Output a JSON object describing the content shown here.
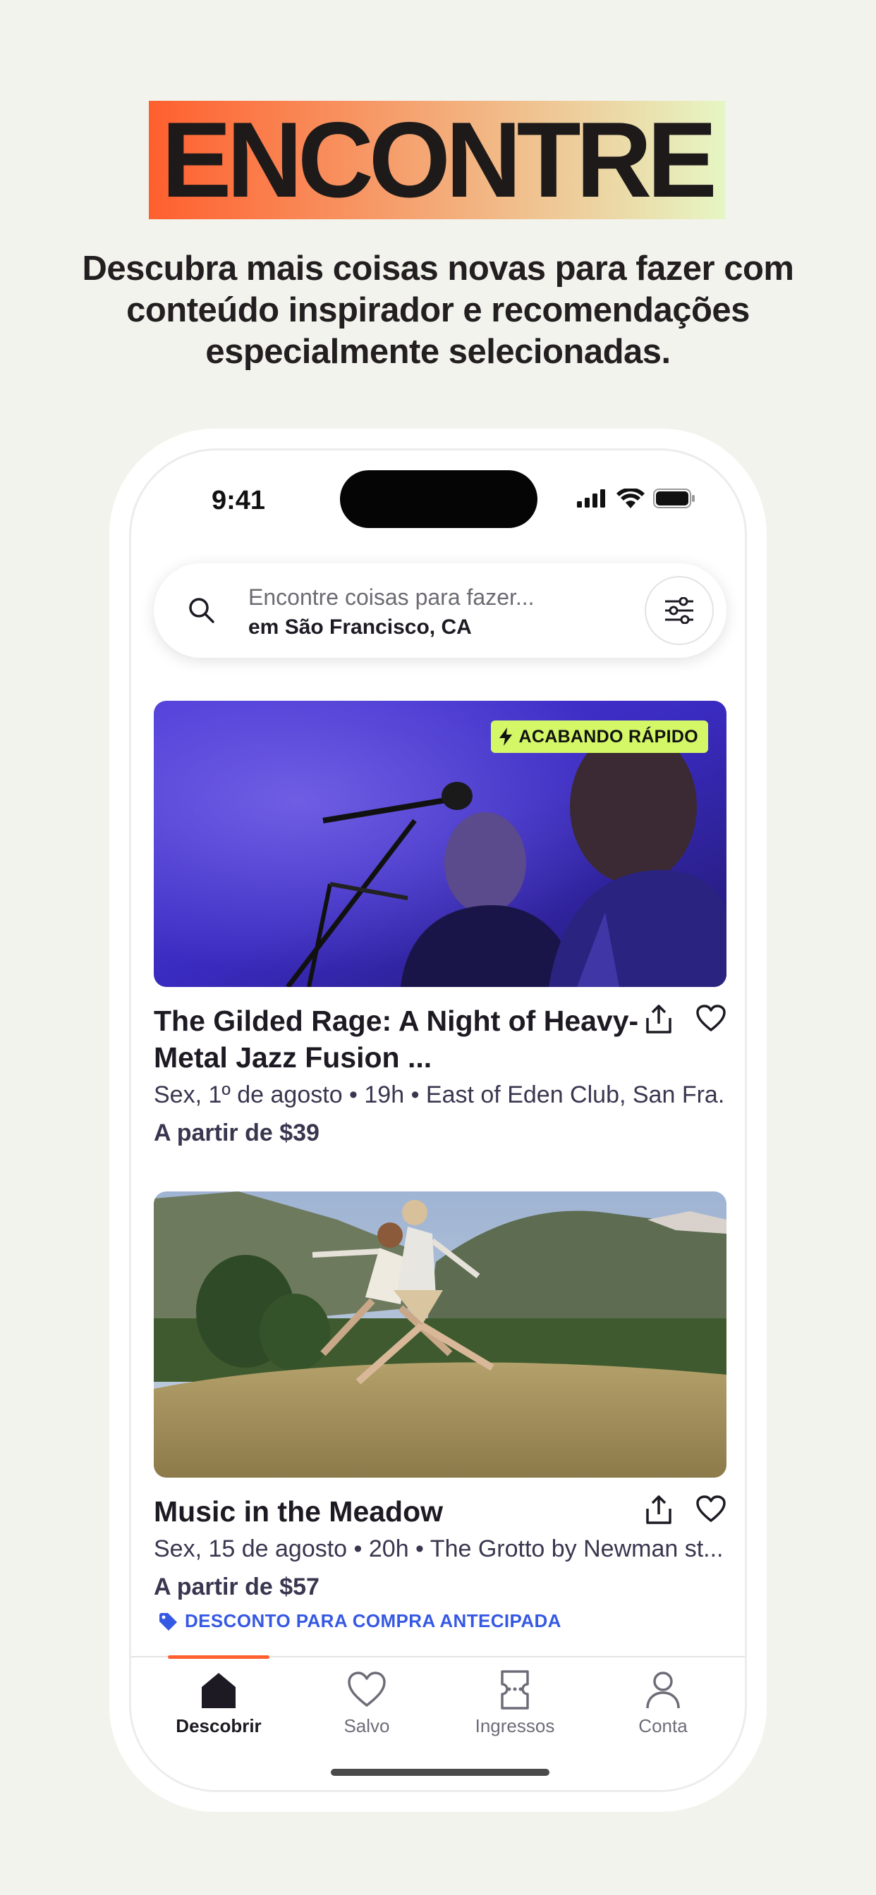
{
  "hero": {
    "title": "ENCONTRE",
    "subtitle": "Descubra mais coisas novas para fazer com conteúdo inspirador e recomendações especialmente selecionadas."
  },
  "status_bar": {
    "time": "9:41",
    "icons": [
      "cellular-signal-icon",
      "wifi-icon",
      "battery-icon"
    ]
  },
  "search": {
    "placeholder": "Encontre coisas para fazer...",
    "location": "em São Francisco, CA",
    "filter_icon": "sliders-icon"
  },
  "events": [
    {
      "title": "The Gilded Rage: A Night of Heavy-Metal Jazz Fusion ...",
      "badge": "ACABANDO RÁPIDO",
      "meta": "Sex, 1º de agosto • 19h • East of Eden Club, San Fra...",
      "price": "A partir de $39",
      "image": "concert-singers-photo"
    },
    {
      "title": "Music in the Meadow",
      "meta": "Sex, 15 de agosto • 20h • The Grotto by Newman st...",
      "price": "A partir de $57",
      "promo": "DESCONTO PARA COMPRA ANTECIPADA",
      "image": "meadow-jumping-photo"
    }
  ],
  "tabs": [
    {
      "label": "Descobrir",
      "icon": "home-icon",
      "active": true
    },
    {
      "label": "Salvo",
      "icon": "heart-icon",
      "active": false
    },
    {
      "label": "Ingressos",
      "icon": "ticket-icon",
      "active": false
    },
    {
      "label": "Conta",
      "icon": "person-icon",
      "active": false
    }
  ],
  "colors": {
    "accent": "#ff5f2e",
    "badge": "#d3f766",
    "promo": "#3659e3",
    "background": "#f3f3ee"
  }
}
